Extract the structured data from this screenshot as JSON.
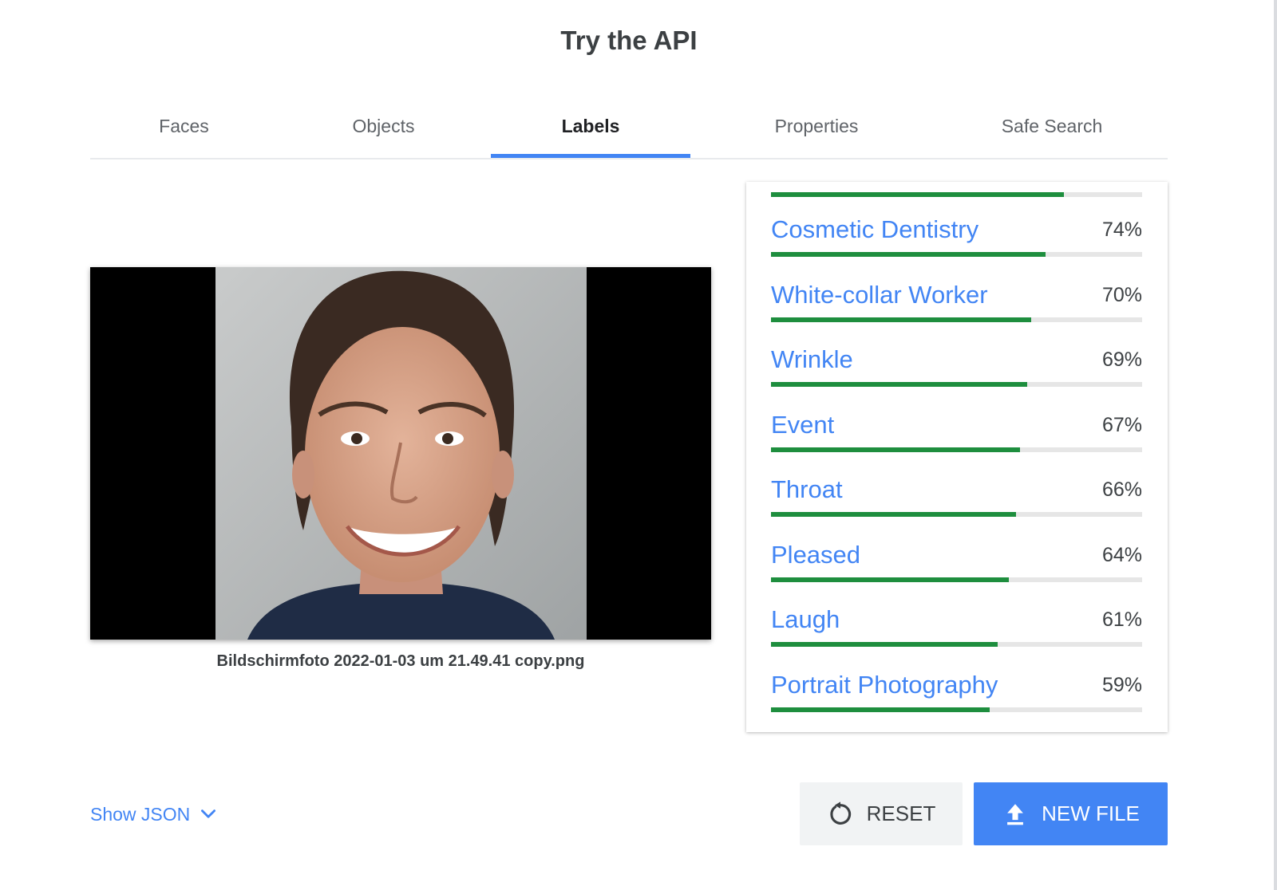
{
  "header": {
    "title": "Try the API"
  },
  "tabs": [
    {
      "label": "Faces"
    },
    {
      "label": "Objects"
    },
    {
      "label": "Labels",
      "active": true
    },
    {
      "label": "Properties"
    },
    {
      "label": "Safe Search"
    }
  ],
  "image_panel": {
    "filename": "Bildschirmfoto 2022-01-03 um 21.49.41 copy.png"
  },
  "labels_panel": {
    "top_partial_bar_fraction": 0.79,
    "items": [
      {
        "name": "Cosmetic Dentistry",
        "percent": "74%",
        "value": 0.74
      },
      {
        "name": "White-collar Worker",
        "percent": "70%",
        "value": 0.7
      },
      {
        "name": "Wrinkle",
        "percent": "69%",
        "value": 0.69
      },
      {
        "name": "Event",
        "percent": "67%",
        "value": 0.67
      },
      {
        "name": "Throat",
        "percent": "66%",
        "value": 0.66
      },
      {
        "name": "Pleased",
        "percent": "64%",
        "value": 0.64
      },
      {
        "name": "Laugh",
        "percent": "61%",
        "value": 0.61
      },
      {
        "name": "Portrait Photography",
        "percent": "59%",
        "value": 0.59
      }
    ]
  },
  "footer": {
    "show_json_label": "Show JSON",
    "reset_label": "RESET",
    "new_file_label": "NEW FILE"
  },
  "colors": {
    "accent": "#4285f4",
    "bar_fill": "#1e8e3e",
    "bar_track": "#e6e6e6",
    "text": "#3c4043"
  },
  "icons": {
    "show_json": "chevron-down-icon",
    "reset": "reset-icon",
    "new_file": "upload-icon"
  }
}
